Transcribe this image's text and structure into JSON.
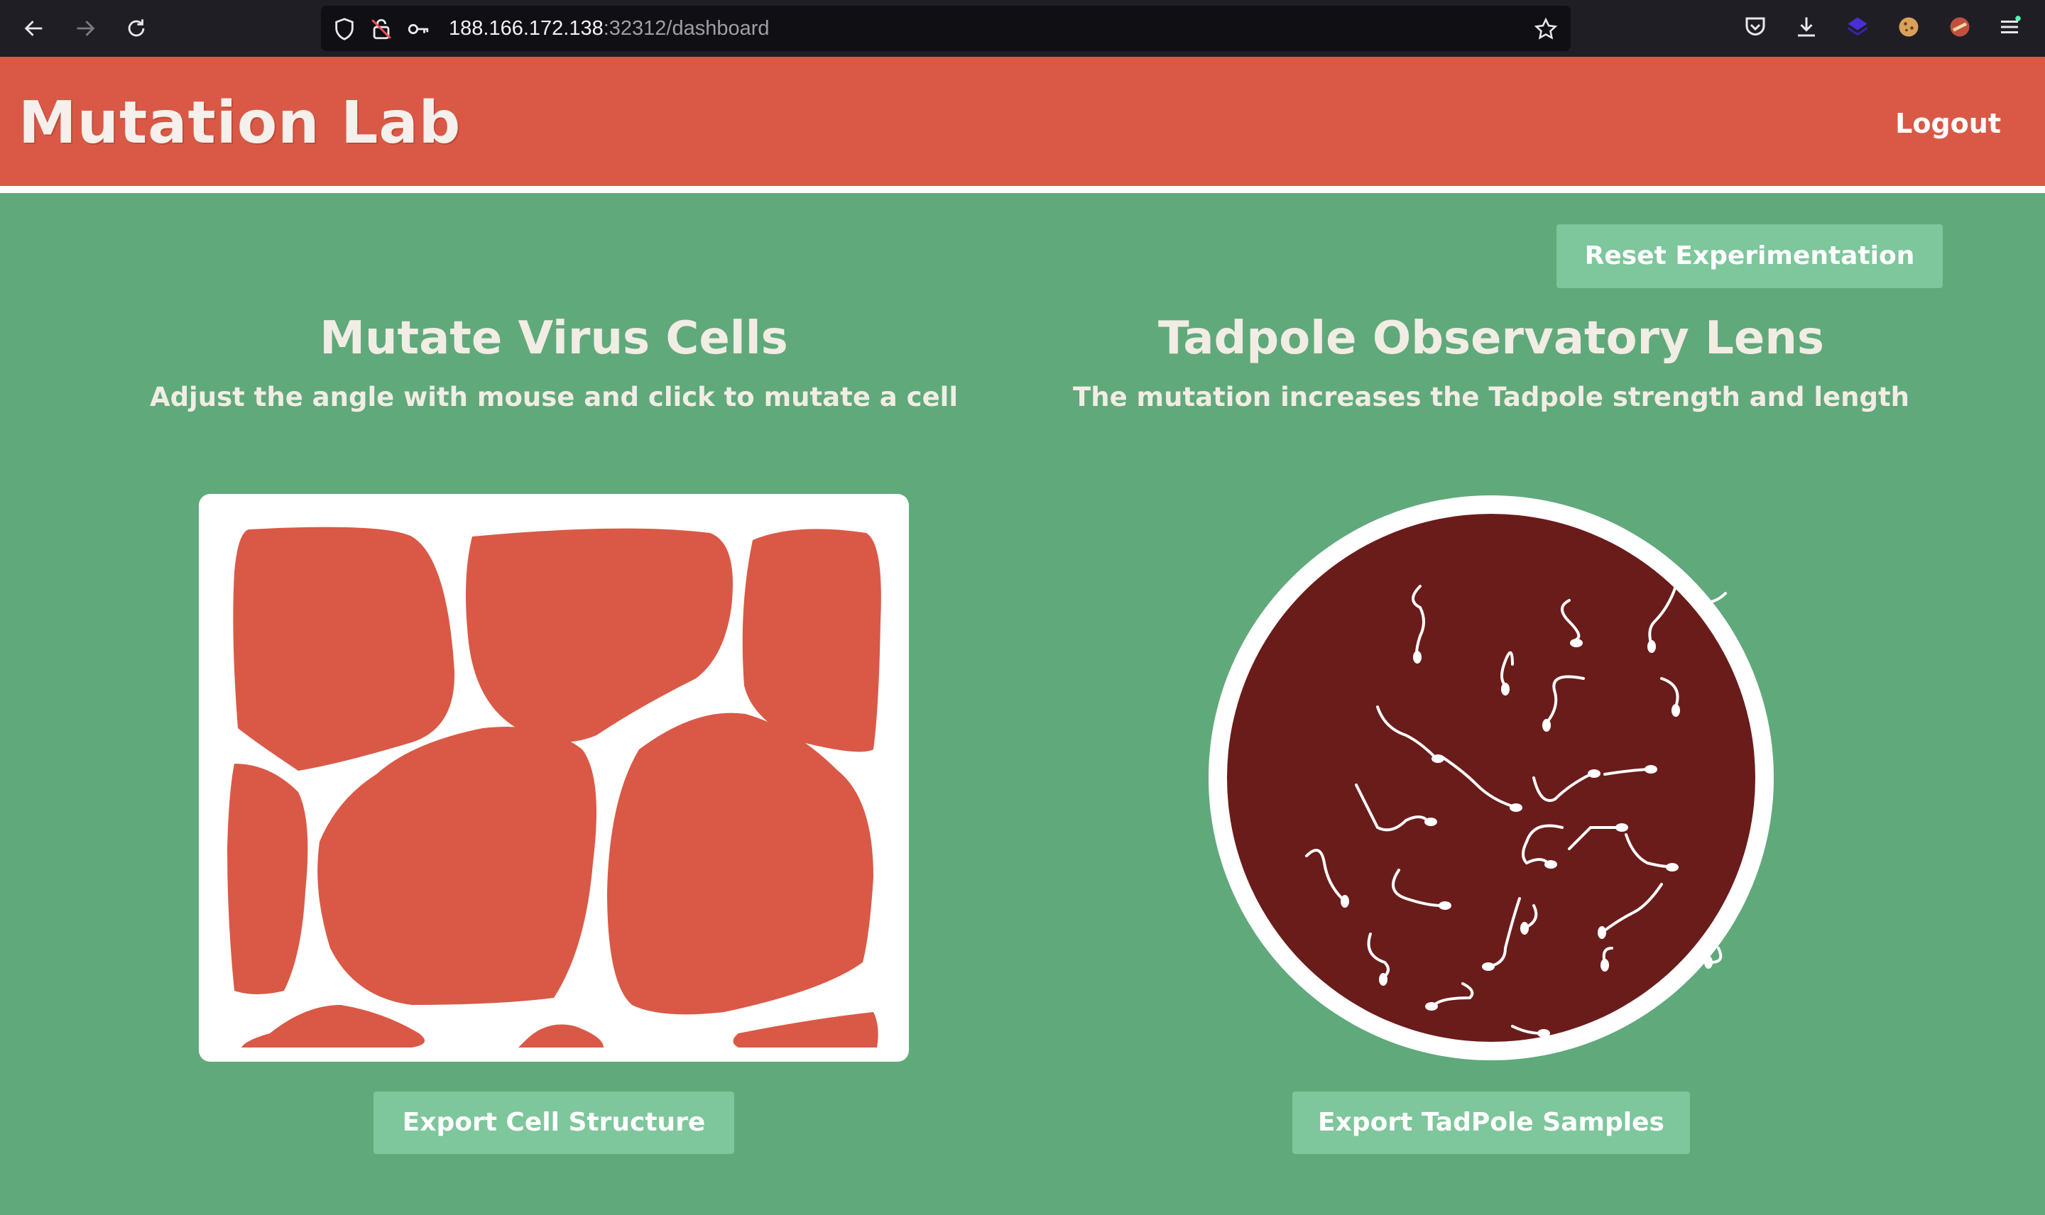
{
  "browser": {
    "url_host": "188.166.172.138",
    "url_rest": ":32312/dashboard",
    "icons": [
      "back-arrow-icon",
      "forward-arrow-icon",
      "reload-icon",
      "shield-icon",
      "blocked-lock-icon",
      "key-icon",
      "star-icon",
      "pocket-icon",
      "download-icon",
      "extension-icon",
      "cookie-icon",
      "extension-avatar-icon",
      "menu-icon"
    ]
  },
  "header": {
    "title": "Mutation Lab",
    "logout_label": "Logout"
  },
  "toolbar": {
    "reset_label": "Reset Experimentation"
  },
  "cells_section": {
    "title": "Mutate Virus Cells",
    "subtitle": "Adjust the angle with mouse and click to mutate a cell",
    "export_label": "Export Cell Structure"
  },
  "lens_section": {
    "title": "Tadpole Observatory Lens",
    "subtitle": "The mutation increases the Tadpole strength and length",
    "export_label": "Export TadPole Samples"
  },
  "colors": {
    "page_bg": "#60a97b",
    "header_bg": "#d95946",
    "button_bg": "#7ec69b",
    "cell_fill": "#d95946",
    "lens_bg": "#6a1c1a"
  }
}
